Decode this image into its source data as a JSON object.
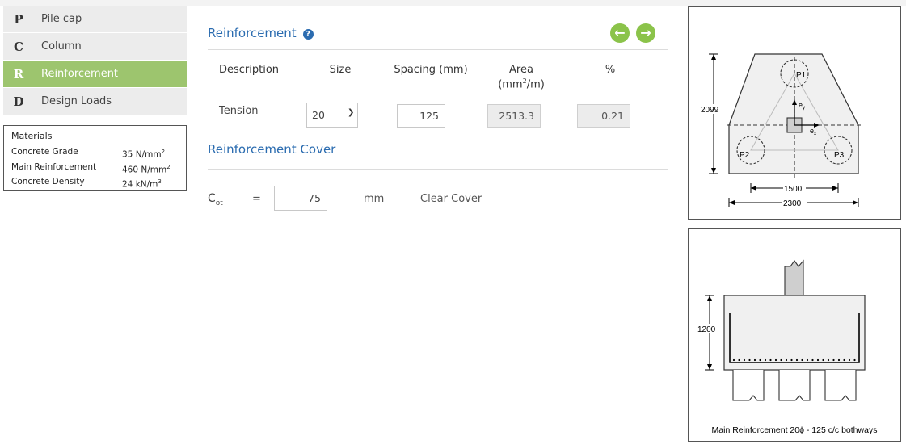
{
  "nav": {
    "items": [
      {
        "letter": "P",
        "label": "Pile cap"
      },
      {
        "letter": "C",
        "label": "Column"
      },
      {
        "letter": "R",
        "label": "Reinforcement"
      },
      {
        "letter": "D",
        "label": "Design Loads"
      }
    ],
    "active_index": 2
  },
  "materials": {
    "title": "Materials",
    "rows": [
      {
        "label": "Concrete Grade",
        "value": "35 N/mm",
        "sup": "2"
      },
      {
        "label": "Main Reinforcement",
        "value": "460 N/mm",
        "sup": "2"
      },
      {
        "label": "Concrete Density",
        "value": "24 kN/m",
        "sup": "3"
      }
    ]
  },
  "reinforcement": {
    "title": "Reinforcement",
    "help_icon": "question-circle-icon",
    "nav_icons": [
      "arrow-left-circle-icon",
      "arrow-right-circle-icon"
    ],
    "columns": {
      "description": "Description",
      "size": "Size",
      "spacing": "Spacing (mm)",
      "area_line1": "Area",
      "area_unit": "(mm",
      "area_sup": "2",
      "area_unit_end": "/m)",
      "percent": "%"
    },
    "row": {
      "label": "Tension",
      "size": "20",
      "spacing": "125",
      "area": "2513.3",
      "percent": "0.21"
    }
  },
  "cover": {
    "title": "Reinforcement Cover",
    "symbol": "C",
    "symbol_sub": "ot",
    "equals": "=",
    "value": "75",
    "unit": "mm",
    "description": "Clear Cover"
  },
  "plan_drawing": {
    "dim_height": "2099",
    "dim_pile_spacing": "1500",
    "dim_width": "2300",
    "piles": [
      "P1",
      "P2",
      "P3"
    ],
    "ey": "e",
    "ey_sub": "y",
    "ex": "e",
    "ex_sub": "x"
  },
  "section_drawing": {
    "dim_depth": "1200",
    "caption": "Main Reinforcement 20ϕ - 125 c/c bothways"
  },
  "colors": {
    "accent_blue": "#2b6cb0",
    "active_green": "#9dc56e",
    "arrow_green": "#8bc34a"
  }
}
